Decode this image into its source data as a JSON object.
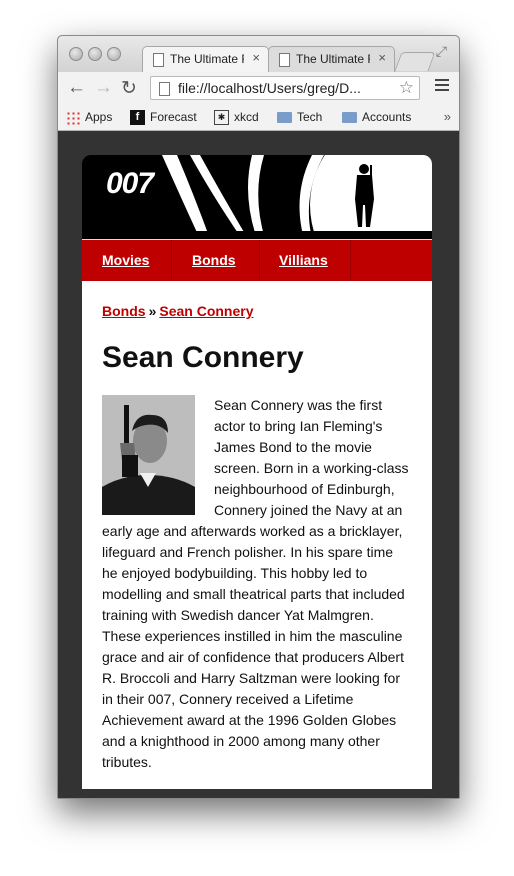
{
  "browser": {
    "tabs": [
      {
        "title": "The Ultimate R",
        "close": "×"
      },
      {
        "title": "The Ultimate R",
        "close": "×"
      }
    ],
    "url": "file://localhost/Users/greg/D...",
    "bookmarks": [
      {
        "label": "Apps",
        "icon": "apps-grid-icon"
      },
      {
        "label": "Forecast",
        "icon": "forecast-icon"
      },
      {
        "label": "xkcd",
        "icon": "xkcd-icon"
      },
      {
        "label": "Tech",
        "icon": "folder-icon"
      },
      {
        "label": "Accounts",
        "icon": "folder-icon"
      }
    ],
    "bookmarks_more": "»"
  },
  "site": {
    "logo": "007",
    "nav": [
      "Movies",
      "Bonds",
      "Villians"
    ],
    "breadcrumb": {
      "parent": "Bonds",
      "separator": "»",
      "current": "Sean Connery"
    },
    "title": "Sean Connery",
    "bio": "Sean Connery was the first actor to bring Ian Fleming's James Bond to the movie screen. Born in a working-class neighbourhood of Edinburgh, Connery joined the Navy at an early age and afterwards worked as a bricklayer, lifeguard and French polisher. In his spare time he enjoyed bodybuilding. This hobby led to modelling and small theatrical parts that included training with Swedish dancer Yat Malmgren. These experiences instilled in him the masculine grace and air of confidence that producers Albert R. Broccoli and Harry Saltzman were looking for in their 007, Connery received a Lifetime Achievement award at the 1996 Golden Globes and a knighthood in 2000 among many other tributes.",
    "colors": {
      "accent": "#bf0000",
      "frame": "#333333"
    }
  }
}
